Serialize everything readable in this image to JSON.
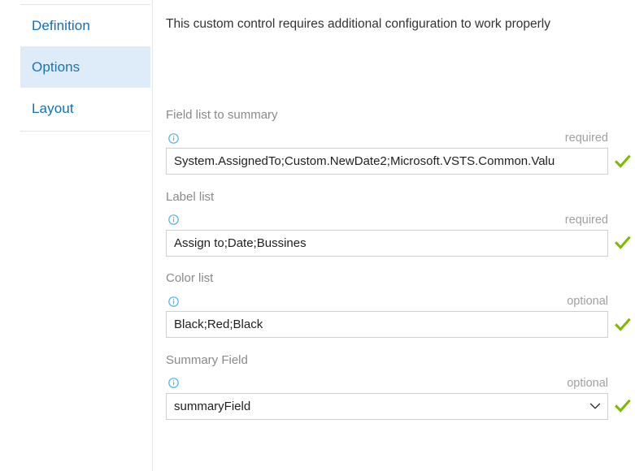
{
  "sidebar": {
    "items": [
      {
        "label": "Definition",
        "selected": false,
        "name": "sidebar-item-definition"
      },
      {
        "label": "Options",
        "selected": true,
        "name": "sidebar-item-options"
      },
      {
        "label": "Layout",
        "selected": false,
        "name": "sidebar-item-layout"
      }
    ]
  },
  "main": {
    "notice": "This custom control requires additional configuration to work properly",
    "fields": [
      {
        "label": "Field list to summary",
        "requirement": "required",
        "value": "System.AssignedTo;Custom.NewDate2;Microsoft.VSTS.Common.Valu",
        "placeholder": "",
        "control": "text",
        "valid": true,
        "info_icon": "info-circle-icon",
        "name": "field-list-to-summary"
      },
      {
        "label": "Label list",
        "requirement": "required",
        "value": "Assign to;Date;Bussines",
        "placeholder": "",
        "control": "text",
        "valid": true,
        "info_icon": "info-circle-icon",
        "name": "label-list"
      },
      {
        "label": "Color list",
        "requirement": "optional",
        "value": "Black;Red;Black",
        "placeholder": "",
        "control": "text",
        "valid": true,
        "info_icon": "info-circle-icon",
        "name": "color-list"
      },
      {
        "label": "Summary Field",
        "requirement": "optional",
        "value": "summaryField",
        "placeholder": "",
        "control": "select",
        "valid": true,
        "info_icon": "info-circle-icon",
        "name": "summary-field"
      }
    ]
  },
  "colors": {
    "link": "#106ebe",
    "selected_tab_background": "#deecf9",
    "valid_check": "#7fba00",
    "info_icon": "#4fb4e8",
    "label_text": "#8a8a8a",
    "notice_text": "#333333",
    "input_border": "#d0d0d0"
  }
}
